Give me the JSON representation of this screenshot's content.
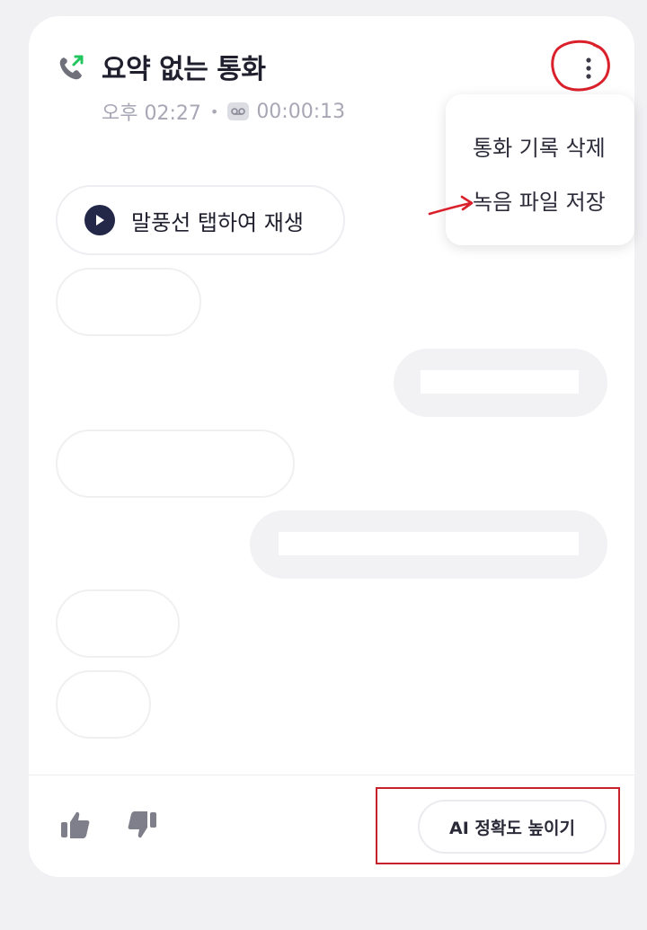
{
  "call": {
    "title": "요약 없는 통화",
    "time": "오후 02:27",
    "separator": "•",
    "duration": "00:00:13"
  },
  "menu": {
    "delete_label": "통화 기록 삭제",
    "save_label": "녹음 파일 저장"
  },
  "player": {
    "play_label": "말풍선 탭하여 재생"
  },
  "footer": {
    "ai_button_label": "AI 정확도 높이기"
  },
  "colors": {
    "accent_navy": "#232748",
    "call_green": "#22c55e",
    "annotation_red": "#c8232c"
  },
  "icons": [
    "outgoing-call-icon",
    "voicemail-icon",
    "more-vertical-icon",
    "play-icon",
    "thumbs-up-icon",
    "thumbs-down-icon"
  ]
}
